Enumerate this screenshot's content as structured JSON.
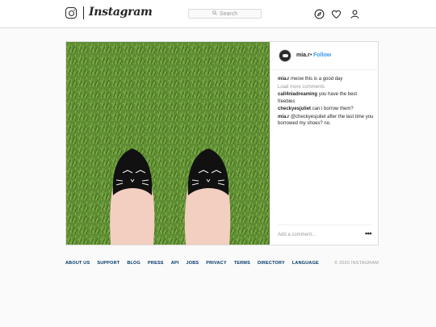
{
  "header": {
    "brand": "Instagram",
    "search_placeholder": "Search"
  },
  "post": {
    "username": "mia.r",
    "dot": "•",
    "follow_label": "Follow",
    "comments": [
      {
        "user": "mia.r",
        "text": "meow this is a good day"
      },
      {
        "user": "call4niadreaming",
        "text": "you have the best freebies"
      },
      {
        "user": "checkyesjuliet",
        "text": "can i borrow them?"
      },
      {
        "user": "mia.r",
        "text": "@checkyesjuliet after the last time you borrowed my shoes? no."
      }
    ],
    "load_more": "Load more comments",
    "add_comment_placeholder": "Add a comment...",
    "more_options": "•••"
  },
  "footer": {
    "links": [
      "ABOUT US",
      "SUPPORT",
      "BLOG",
      "PRESS",
      "API",
      "JOBS",
      "PRIVACY",
      "TERMS",
      "DIRECTORY",
      "LANGUAGE"
    ],
    "copyright": "© 2020 INSTAGRAM"
  },
  "colors": {
    "link": "#003569",
    "follow": "#3897f0",
    "border": "#dbdbdb",
    "grass": "#5f8f34"
  },
  "icons": [
    "instagram-logo-icon",
    "search-icon",
    "compass-icon",
    "heart-icon",
    "profile-icon",
    "more-options-icon"
  ]
}
